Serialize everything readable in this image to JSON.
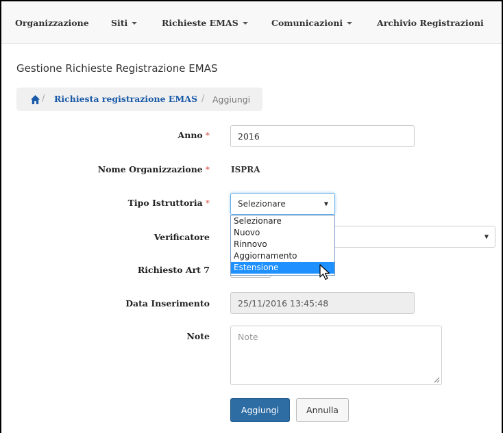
{
  "navbar": {
    "items": [
      {
        "label": "Organizzazione",
        "dropdown": false
      },
      {
        "label": "Siti",
        "dropdown": true
      },
      {
        "label": "Richieste EMAS",
        "dropdown": true
      },
      {
        "label": "Comunicazioni",
        "dropdown": true
      },
      {
        "label": "Archivio Registrazioni",
        "dropdown": false
      }
    ]
  },
  "page": {
    "title": "Gestione Richieste Registrazione EMAS"
  },
  "breadcrumb": {
    "separator": "/",
    "link": "Richiesta registrazione EMAS",
    "current": "Aggiungi"
  },
  "form": {
    "required_mark": "*",
    "anno": {
      "label": "Anno",
      "value": "2016"
    },
    "nome_organizzazione": {
      "label": "Nome Organizzazione",
      "value": "ISPRA"
    },
    "tipo_istruttoria": {
      "label": "Tipo Istruttoria",
      "selected": "Selezionare",
      "options": [
        "Selezionare",
        "Nuovo",
        "Rinnovo",
        "Aggiornamento",
        "Estensione"
      ],
      "highlighted": "Estensione"
    },
    "verificatore": {
      "label": "Verificatore",
      "value": ""
    },
    "richiesto_art7": {
      "label": "Richiesto Art 7"
    },
    "data_inserimento": {
      "label": "Data Inserimento",
      "value": "25/11/2016 13:45:48"
    },
    "note": {
      "label": "Note",
      "placeholder": "Note"
    }
  },
  "buttons": {
    "submit": "Aggiungi",
    "cancel": "Annulla"
  },
  "colors": {
    "link": "#1a5aa8",
    "required": "#d9534f",
    "primary": "#2e6da4",
    "highlight": "#1e90ff"
  }
}
